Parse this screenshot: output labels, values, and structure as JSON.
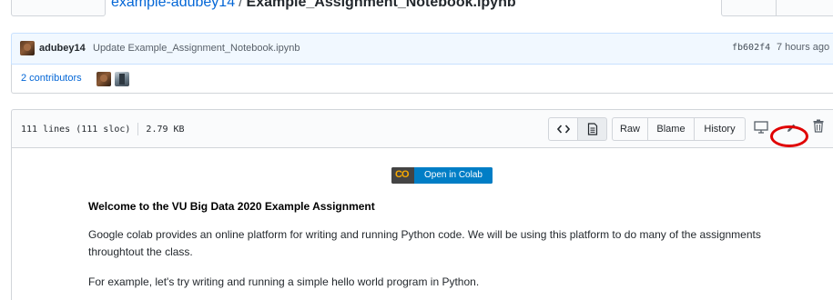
{
  "breadcrumb": {
    "repo": "example-adubey14",
    "separator": "/",
    "file": "Example_Assignment_Notebook.ipynb"
  },
  "commit": {
    "author": "adubey14",
    "message": "Update Example_Assignment_Notebook.ipynb",
    "sha": "fb602f4",
    "time": "7 hours ago"
  },
  "contributors": {
    "label": "2 contributors"
  },
  "file_header": {
    "lines": "111 lines (111 sloc)",
    "size": "2.79 KB",
    "buttons": {
      "raw": "Raw",
      "blame": "Blame",
      "history": "History"
    },
    "icons": [
      "code-icon",
      "file-text-icon",
      "desktop-icon",
      "pencil-icon",
      "trash-icon"
    ]
  },
  "content": {
    "badge_logo": "CO",
    "badge_label": "Open in Colab",
    "heading": "Welcome to the VU Big Data 2020 Example Assignment",
    "paragraph1": "Google colab provides an online platform for writing and running Python code. We will be using this platform to do many of the assignments throughtout the class.",
    "paragraph2": "For example, let's try writing and running a simple hello world program in Python."
  },
  "colors": {
    "link": "#0366d6",
    "annotation": "#e00000",
    "colab_blue": "#007ec6",
    "colab_orange": "#f9ab00"
  }
}
